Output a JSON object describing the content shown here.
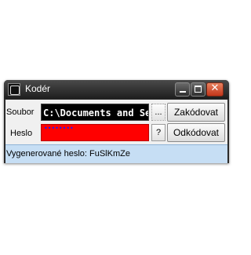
{
  "window": {
    "title": "Kodér",
    "icon": "app-icon"
  },
  "form": {
    "file_label": "Soubor",
    "file_value": "C:\\Documents and Se",
    "password_label": "Heslo",
    "password_masked": "••••••••",
    "browse_label": "...",
    "help_label": "?",
    "encode_label": "Zakódovat",
    "decode_label": "Odkódovat"
  },
  "status": {
    "text": "Vygenerované heslo: FuSlKmZe"
  },
  "colors": {
    "file_field_bg": "#000000",
    "password_field_bg": "#ff0000",
    "status_bar_bg": "#c6def4"
  }
}
